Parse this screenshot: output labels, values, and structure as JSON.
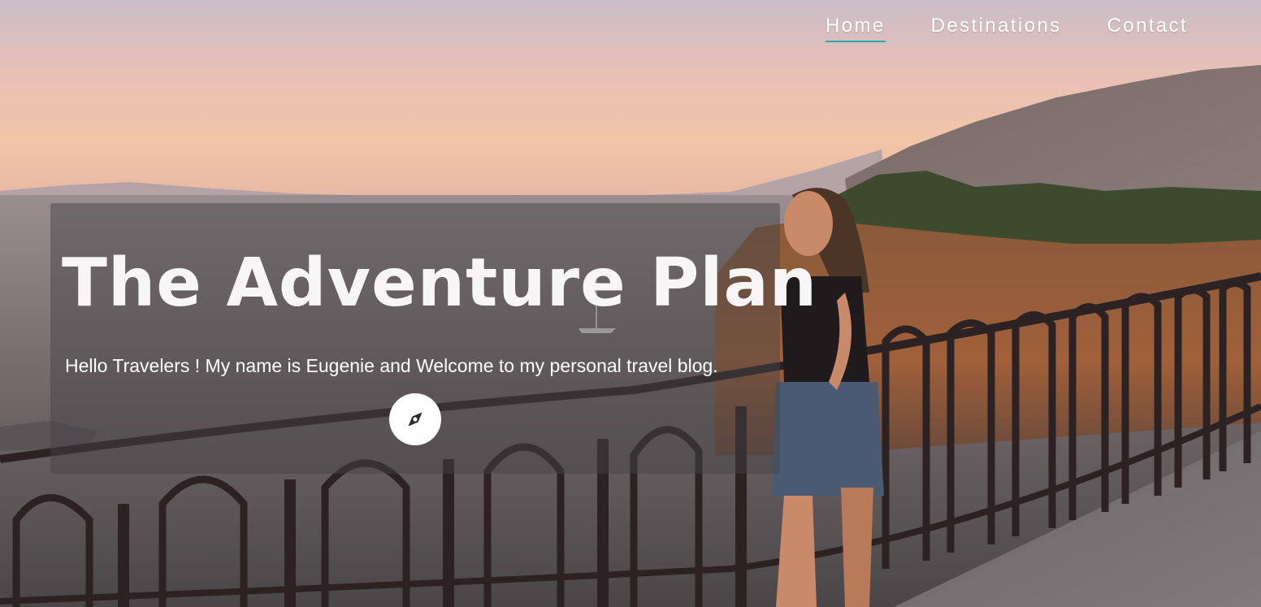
{
  "nav": {
    "items": [
      {
        "label": "Home",
        "active": true
      },
      {
        "label": "Destinations",
        "active": false
      },
      {
        "label": "Contact",
        "active": false
      }
    ],
    "accent_color": "#2aa6a8"
  },
  "hero": {
    "title": "The Adventure Plan",
    "subtitle": "Hello Travelers ! My name is Eugenie and Welcome to my personal travel blog.",
    "cta_icon": "compass-icon",
    "background": "sunset-coastal-balcony-photo"
  }
}
